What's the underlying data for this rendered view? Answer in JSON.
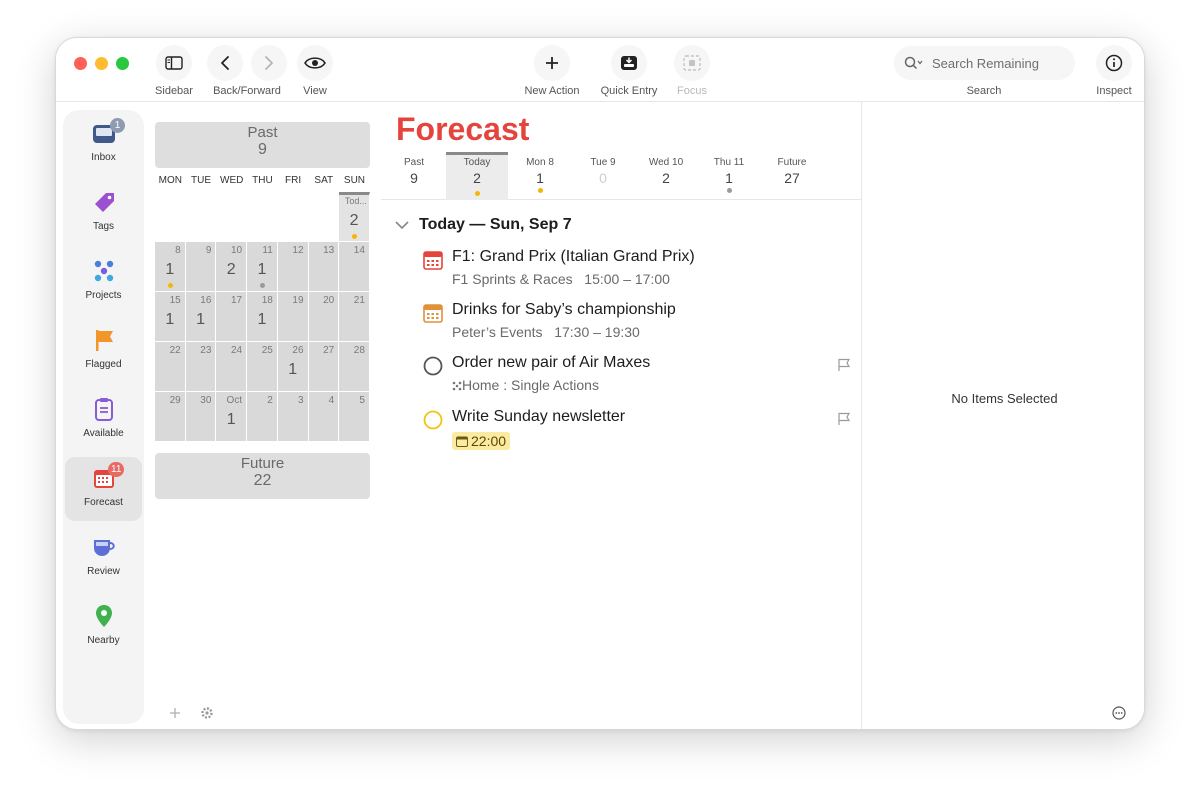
{
  "toolbar": {
    "sidebar_label": "Sidebar",
    "backforward_label": "Back/Forward",
    "view_label": "View",
    "new_action_label": "New Action",
    "quick_entry_label": "Quick Entry",
    "focus_label": "Focus",
    "search_placeholder": "Search Remaining",
    "search_label": "Search",
    "inspect_label": "Inspect"
  },
  "sidebar": {
    "items": [
      {
        "label": "Inbox",
        "icon": "inbox-icon",
        "badge": "1"
      },
      {
        "label": "Tags",
        "icon": "tag-icon"
      },
      {
        "label": "Projects",
        "icon": "projects-icon"
      },
      {
        "label": "Flagged",
        "icon": "flag-icon"
      },
      {
        "label": "Available",
        "icon": "clipboard-icon"
      },
      {
        "label": "Forecast",
        "icon": "calendar-icon",
        "badge": "11"
      },
      {
        "label": "Review",
        "icon": "cup-icon"
      },
      {
        "label": "Nearby",
        "icon": "pin-icon"
      }
    ]
  },
  "calendar": {
    "past_label": "Past",
    "past_count": "9",
    "future_label": "Future",
    "future_count": "22",
    "weekdays": [
      "MON",
      "TUE",
      "WED",
      "THU",
      "FRI",
      "SAT",
      "SUN"
    ],
    "today_label": "Tod...",
    "today_count": "2",
    "weeks": [
      [
        {
          "d": "8",
          "c": "1",
          "dot": "#f2b705"
        },
        {
          "d": "9",
          "c": ""
        },
        {
          "d": "10",
          "c": "2"
        },
        {
          "d": "11",
          "c": "1",
          "dot": "#9a9a9a"
        },
        {
          "d": "12",
          "c": ""
        },
        {
          "d": "13",
          "c": ""
        },
        {
          "d": "14",
          "c": ""
        }
      ],
      [
        {
          "d": "15",
          "c": "1"
        },
        {
          "d": "16",
          "c": "1"
        },
        {
          "d": "17",
          "c": ""
        },
        {
          "d": "18",
          "c": "1"
        },
        {
          "d": "19",
          "c": ""
        },
        {
          "d": "20",
          "c": ""
        },
        {
          "d": "21",
          "c": ""
        }
      ],
      [
        {
          "d": "22",
          "c": ""
        },
        {
          "d": "23",
          "c": ""
        },
        {
          "d": "24",
          "c": ""
        },
        {
          "d": "25",
          "c": ""
        },
        {
          "d": "26",
          "c": "1"
        },
        {
          "d": "27",
          "c": ""
        },
        {
          "d": "28",
          "c": ""
        }
      ],
      [
        {
          "d": "29",
          "c": ""
        },
        {
          "d": "30",
          "c": ""
        },
        {
          "d": "Oct",
          "c": "1"
        },
        {
          "d": "2",
          "c": ""
        },
        {
          "d": "3",
          "c": ""
        },
        {
          "d": "4",
          "c": ""
        },
        {
          "d": "5",
          "c": ""
        }
      ]
    ]
  },
  "forecast": {
    "title": "Forecast",
    "tabs": [
      {
        "label": "Past",
        "count": "9"
      },
      {
        "label": "Today",
        "count": "2",
        "dot": "#f2b705",
        "selected": true
      },
      {
        "label": "Mon 8",
        "count": "1",
        "dot": "#f2b705"
      },
      {
        "label": "Tue 9",
        "count": "0",
        "zero": true
      },
      {
        "label": "Wed 10",
        "count": "2"
      },
      {
        "label": "Thu 11",
        "count": "1",
        "dot": "#9a9a9a"
      },
      {
        "label": "Future",
        "count": "27"
      }
    ],
    "section_heading": "Today — Sun, Sep 7",
    "items": [
      {
        "title": "F1: Grand Prix (Italian Grand Prix)",
        "calendar": "F1 Sprints & Races",
        "time": "15:00 – 17:00",
        "color": "#e5443c"
      },
      {
        "title": "Drinks for Saby’s championship",
        "calendar": "Peter’s Events",
        "time": "17:30 – 19:30",
        "color": "#e0913a"
      },
      {
        "title": "Order new pair of Air Maxes",
        "context": "Home : Single Actions"
      },
      {
        "title": "Write Sunday newsletter",
        "due": "22:00"
      }
    ]
  },
  "inspector": {
    "empty_text": "No Items Selected"
  },
  "colors": {
    "accent": "#e5443c",
    "due_soon": "#f2b705"
  }
}
